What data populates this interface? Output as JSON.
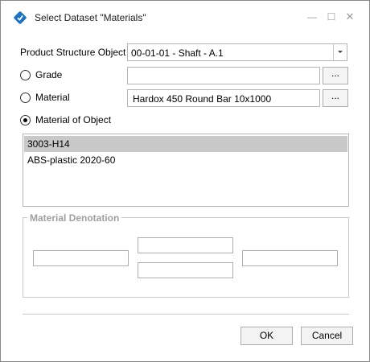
{
  "window": {
    "title": "Select Dataset \"Materials\"",
    "minimize_glyph": "—",
    "maximize_glyph": "☐",
    "close_glyph": "✕"
  },
  "product_structure": {
    "label": "Product Structure Object",
    "value": "00-01-01 - Shaft - A.1"
  },
  "grade": {
    "label": "Grade",
    "value": "",
    "browse_label": "..."
  },
  "material": {
    "label": "Material",
    "value": "Hardox 450 Round Bar 10x1000",
    "browse_label": "..."
  },
  "material_of_object": {
    "label": "Material of Object",
    "items": [
      "3003-H14",
      "ABS-plastic 2020-60"
    ]
  },
  "material_denotation": {
    "title": "Material Denotation"
  },
  "buttons": {
    "ok": "OK",
    "cancel": "Cancel"
  },
  "colors": {
    "accent": "#1e73be",
    "selection": "#c8c8c8",
    "disabled_text": "#9f9f9f"
  },
  "icons": [
    "app-logo-icon",
    "minimize-icon",
    "maximize-icon",
    "close-icon",
    "dropdown-arrow-icon"
  ]
}
